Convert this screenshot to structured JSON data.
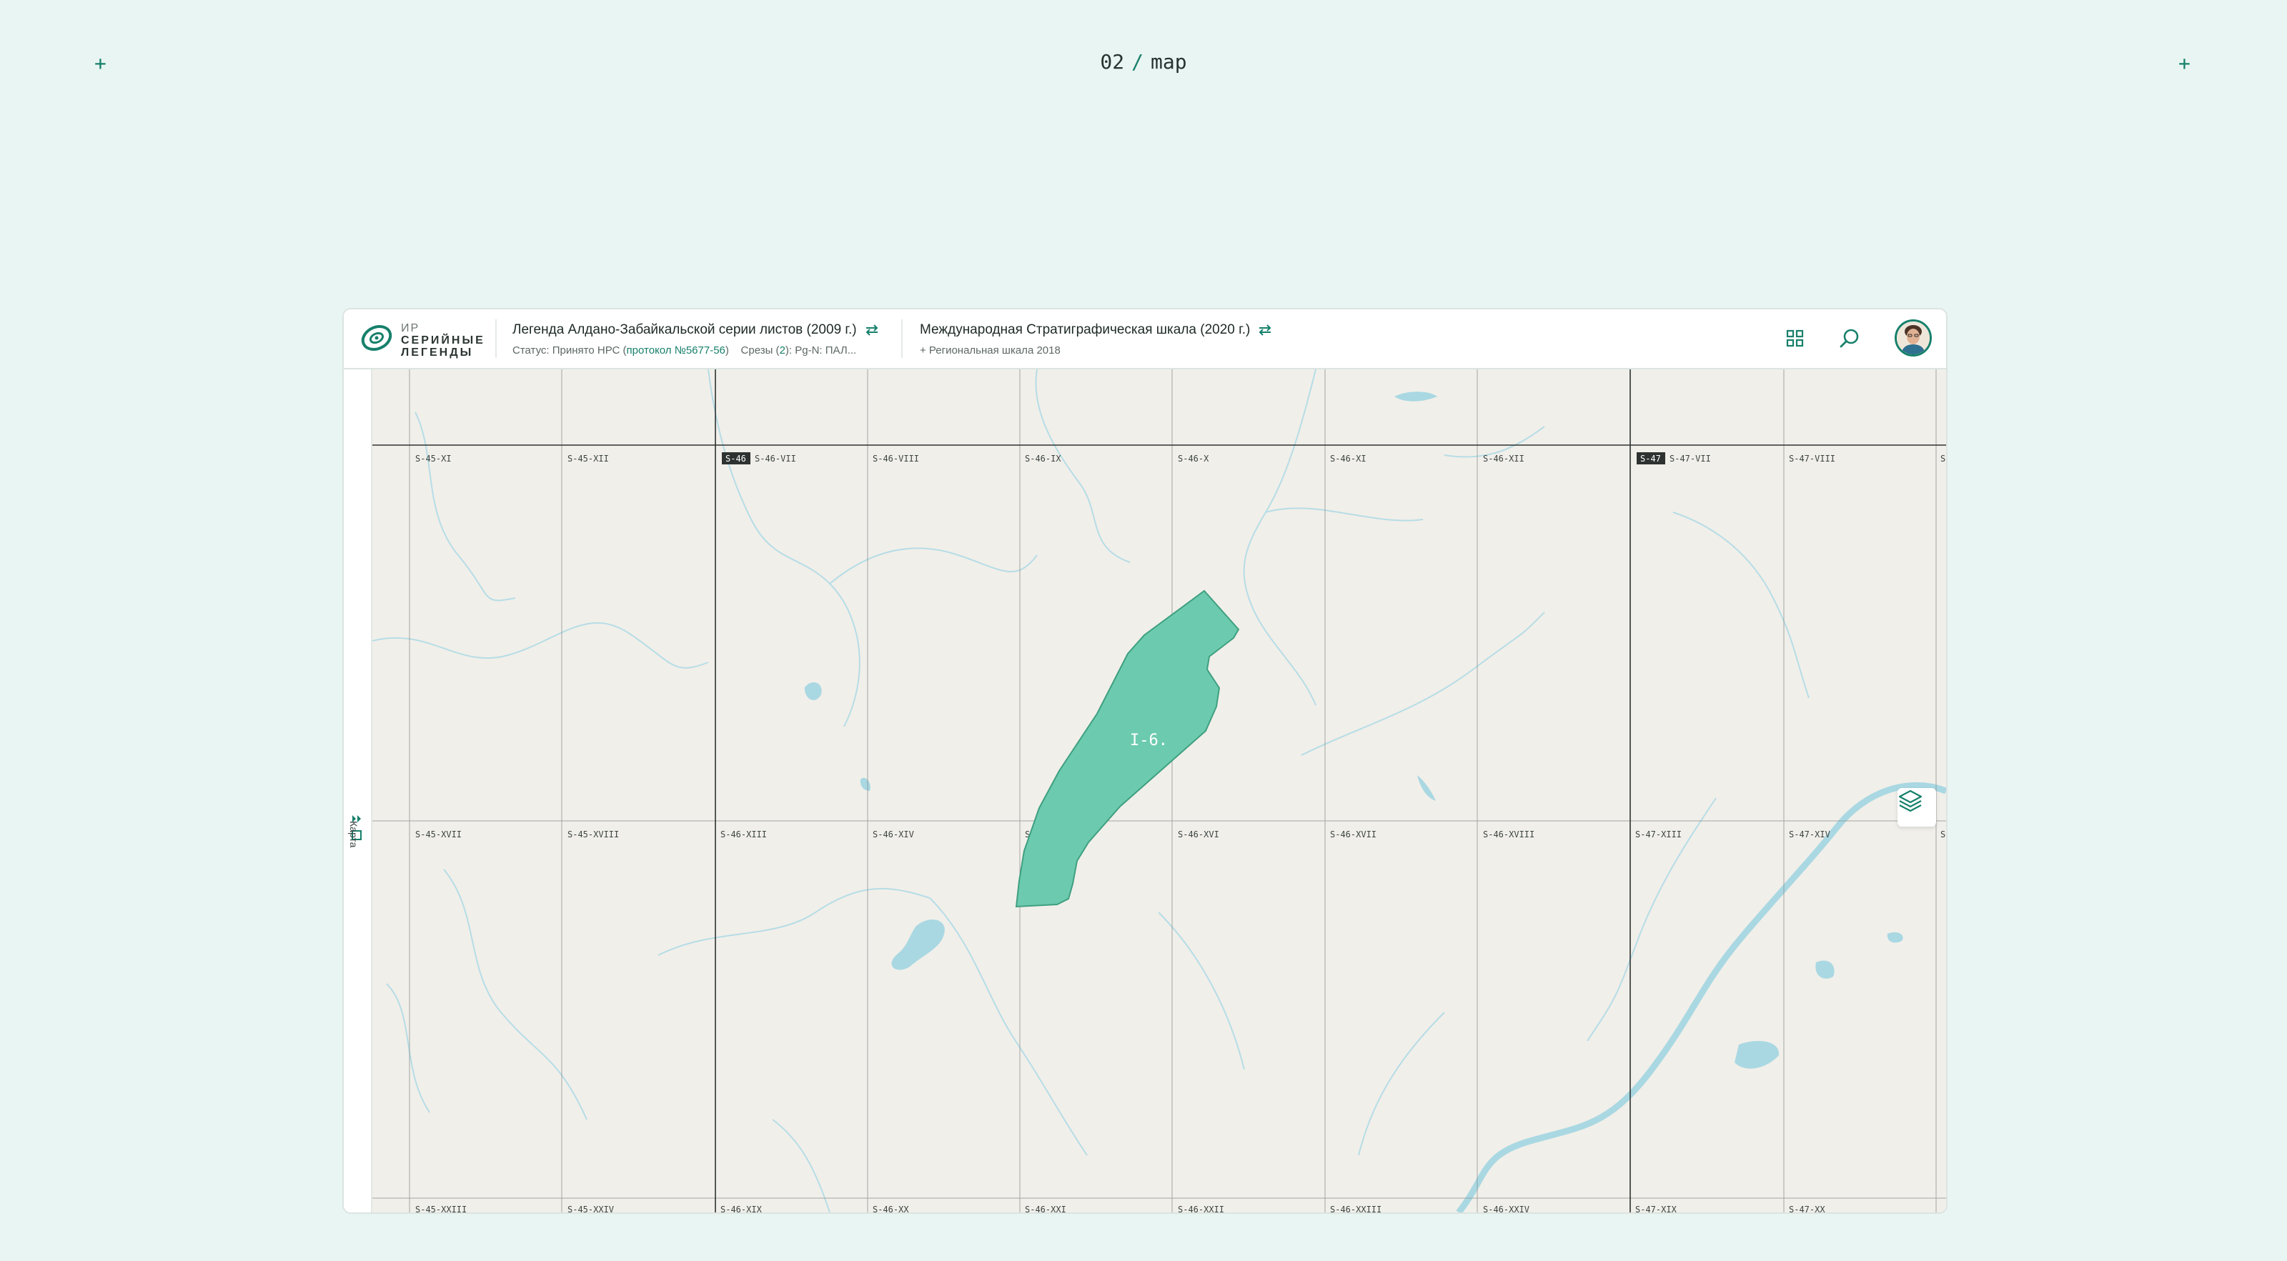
{
  "page": {
    "number": "02",
    "slash": "/",
    "name": "map",
    "plus_left": "+",
    "plus_right": "+"
  },
  "logo": {
    "line1": "ИР",
    "line2": "СЕРИЙНЫЕ",
    "line3": "ЛЕГЕНДЫ"
  },
  "legend": {
    "title": "Легенда Алдано-Забайкальской серии листов (2009 г.)",
    "status_prefix": "Статус: Принято НРС (",
    "protocol_link": "протокол №5677-56",
    "status_suffix": ")",
    "cuts_prefix": "Срезы (",
    "cuts_count": "2",
    "cuts_suffix": "): Pg-N: ПАЛ..."
  },
  "scale": {
    "title": "Международная Стратиграфическая шкала (2020 г.)",
    "subtitle": "+ Региональная шкала 2018"
  },
  "toolbar": {
    "grid_icon": "grid-icon",
    "search_icon": "search-icon",
    "avatar": "avatar"
  },
  "sidebar": {
    "label": "Карта",
    "expand_icon": "double-chevron-right-icon",
    "square_icon": "square-icon"
  },
  "map": {
    "colors": {
      "land": "#f1efea",
      "water": "#a9d8e2",
      "zone": "#6ccbae",
      "zone_stroke": "#3e9f80",
      "accent": "#17806b"
    },
    "sheet_badges": [
      "S-46",
      "S-47"
    ],
    "row1": [
      "S-45-XI",
      "S-45-XII",
      "S-46-VII",
      "S-46-VIII",
      "S-46-IX",
      "S-46-X",
      "S-46-XI",
      "S-46-XII",
      "S-47-VII",
      "S-47-VIII",
      "S"
    ],
    "row2": [
      "S-45-XVII",
      "S-45-XVIII",
      "S-46-XIII",
      "S-46-XIV",
      "S-46-XV",
      "S-46-XVI",
      "S-46-XVII",
      "S-46-XVIII",
      "S-47-XIII",
      "S-47-XIV",
      "S"
    ],
    "row3": [
      "S-45-XXIII",
      "S-45-XXIV",
      "S-46-XIX",
      "S-46-XX",
      "S-46-XXI",
      "S-46-XXII",
      "S-46-XXIII",
      "S-46-XXIV",
      "S-47-XIX",
      "S-47-XX"
    ],
    "zone_label": "I-6.",
    "layers_icon": "layers-icon",
    "upload_icon": "upload-icon",
    "download_icon": "download-icon"
  }
}
